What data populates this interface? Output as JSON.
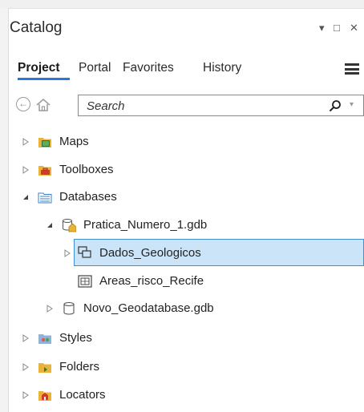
{
  "panel": {
    "title": "Catalog",
    "controls": {
      "pin": "▾",
      "maximize": "□",
      "close": "✕"
    }
  },
  "tabs": [
    {
      "label": "Project",
      "active": true
    },
    {
      "label": "Portal",
      "active": false
    },
    {
      "label": "Favorites",
      "active": false
    },
    {
      "label": "History",
      "active": false
    }
  ],
  "search": {
    "placeholder": "Search",
    "value": ""
  },
  "tree": [
    {
      "label": "Maps",
      "icon": "maps-folder-icon",
      "expanded": false
    },
    {
      "label": "Toolboxes",
      "icon": "toolboxes-folder-icon",
      "expanded": false
    },
    {
      "label": "Databases",
      "icon": "databases-folder-icon",
      "expanded": true
    },
    {
      "label": "Pratica_Numero_1.gdb",
      "icon": "geodatabase-home-icon",
      "expanded": true
    },
    {
      "label": "Dados_Geologicos",
      "icon": "feature-dataset-icon",
      "expanded": false,
      "selected": true
    },
    {
      "label": "Areas_risco_Recife",
      "icon": "raster-dataset-icon"
    },
    {
      "label": "Novo_Geodatabase.gdb",
      "icon": "geodatabase-icon",
      "expanded": false
    },
    {
      "label": "Styles",
      "icon": "styles-folder-icon",
      "expanded": false
    },
    {
      "label": "Folders",
      "icon": "folders-folder-icon",
      "expanded": false
    },
    {
      "label": "Locators",
      "icon": "locators-folder-icon",
      "expanded": false
    }
  ],
  "colors": {
    "accent": "#2a78d6",
    "selection_bg": "#cce4f7",
    "selection_border": "#3e8fd8",
    "folder": "#e8b33a"
  }
}
